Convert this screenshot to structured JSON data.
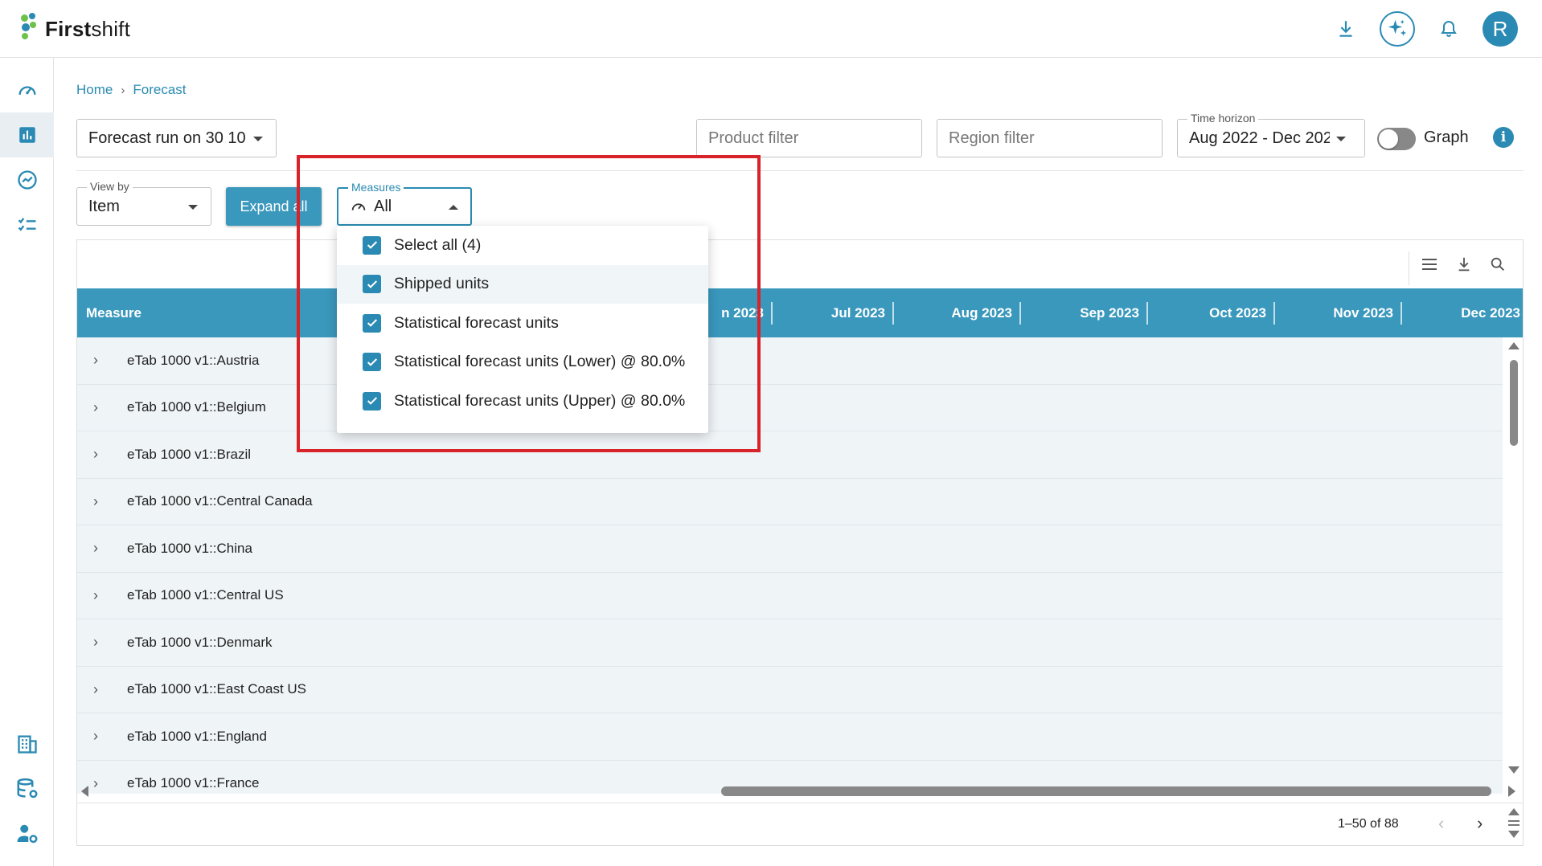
{
  "app": {
    "logo_text_bold": "First",
    "logo_text_light": "shift",
    "avatar_initial": "R"
  },
  "breadcrumb": {
    "home": "Home",
    "separator": "›",
    "current": "Forecast"
  },
  "filters": {
    "forecast_run": "Forecast run on 30 10",
    "product_filter_placeholder": "Product filter",
    "region_filter_placeholder": "Region filter",
    "time_horizon_label": "Time horizon",
    "time_horizon_value": "Aug 2022 - Dec 202",
    "graph_toggle_label": "Graph",
    "graph_toggle_on": false,
    "info_glyph": "i"
  },
  "controls": {
    "view_by_label": "View by",
    "view_by_value": "Item",
    "expand_button": "Expand all",
    "measures_label": "Measures",
    "measures_value": "All"
  },
  "measures_menu": {
    "items": [
      {
        "label": "Select all (4)",
        "checked": true
      },
      {
        "label": "Shipped units",
        "checked": true
      },
      {
        "label": "Statistical forecast units",
        "checked": true
      },
      {
        "label": "Statistical forecast units (Lower) @ 80.0%",
        "checked": true
      },
      {
        "label": "Statistical forecast units (Upper) @ 80.0%",
        "checked": true
      }
    ]
  },
  "table": {
    "measure_header": "Measure",
    "month_headers": [
      "n 2023",
      "Jul 2023",
      "Aug 2023",
      "Sep 2023",
      "Oct 2023",
      "Nov 2023",
      "Dec 2023"
    ],
    "rows": [
      "eTab 1000 v1::Austria",
      "eTab 1000 v1::Belgium",
      "eTab 1000 v1::Brazil",
      "eTab 1000 v1::Central Canada",
      "eTab 1000 v1::China",
      "eTab 1000 v1::Central US",
      "eTab 1000 v1::Denmark",
      "eTab 1000 v1::East Coast US",
      "eTab 1000 v1::England",
      "eTab 1000 v1::France"
    ],
    "pagination": "1–50 of 88"
  },
  "colors": {
    "brand": "#2a8ab3",
    "header": "#3a98bd",
    "highlight_box": "#d9232b",
    "row_bg": "#eff4f7"
  },
  "icons": {
    "top": [
      "download-icon",
      "ai-sparkle-icon",
      "bell-icon"
    ],
    "sidebar": [
      "dashboard-icon",
      "bar-chart-icon",
      "trend-icon",
      "checklist-icon",
      "building-icon",
      "database-settings-icon",
      "user-settings-icon"
    ],
    "toolbar": [
      "columns-icon",
      "download-icon",
      "search-icon"
    ]
  }
}
